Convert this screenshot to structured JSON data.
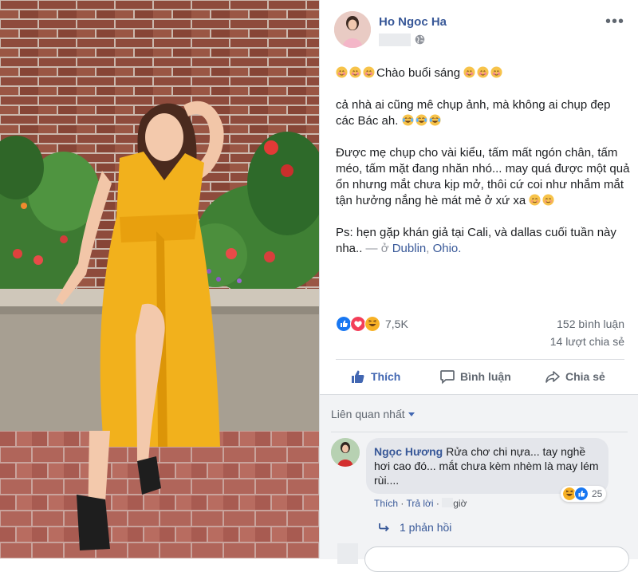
{
  "post": {
    "author": "Ho Ngoc Ha",
    "paragraphs": {
      "p1": "Chào buổi sáng",
      "p2": "cả nhà ai cũng mê chụp ảnh, mà không ai chụp đẹp các Bác ah.",
      "p3": "Được mẹ chụp cho vài kiểu, tấm mất ngón chân, tấm méo, tấm mặt đang nhăn nhó... may quá được một quả ổn nhưng mắt chưa kịp mở, thôi cứ coi như nhắm mắt tận hưởng nắng hè mát mẻ ở xứ xa",
      "p4": "Ps: hẹn gặp khán giả tại Cali, và dallas cuối tuần này nha..",
      "location_prefix": " — ở ",
      "location_city": "Dublin",
      "location_sep": ", ",
      "location_state": "Ohio."
    },
    "emoji_icons": [
      "smiling-face-with-hearts-icon",
      "face-with-tears-of-joy-icon",
      "smiling-face-icon"
    ]
  },
  "stats": {
    "reactions": "7,5K",
    "comments": "152 bình luận",
    "shares": "14 lượt chia sẻ",
    "reaction_icons": [
      "like-icon",
      "love-icon",
      "haha-icon"
    ]
  },
  "actions": {
    "like": "Thích",
    "comment": "Bình luận",
    "share": "Chia sẻ"
  },
  "comments": {
    "sort_label": "Liên quan nhất",
    "first": {
      "name": "Ngọc Hương",
      "text": "Rửa chơ chi nựa... tay nghề hơi cao đó... mắt chưa kèm nhèm là may lém rùi....",
      "reaction_count": "25",
      "like": "Thích",
      "dot": " · ",
      "reply": "Trả lời",
      "time_unit": "giờ",
      "replies": "1 phản hồi"
    }
  },
  "colors": {
    "brand": "#4267b2",
    "link": "#385898",
    "dress": "#f2b11c"
  }
}
